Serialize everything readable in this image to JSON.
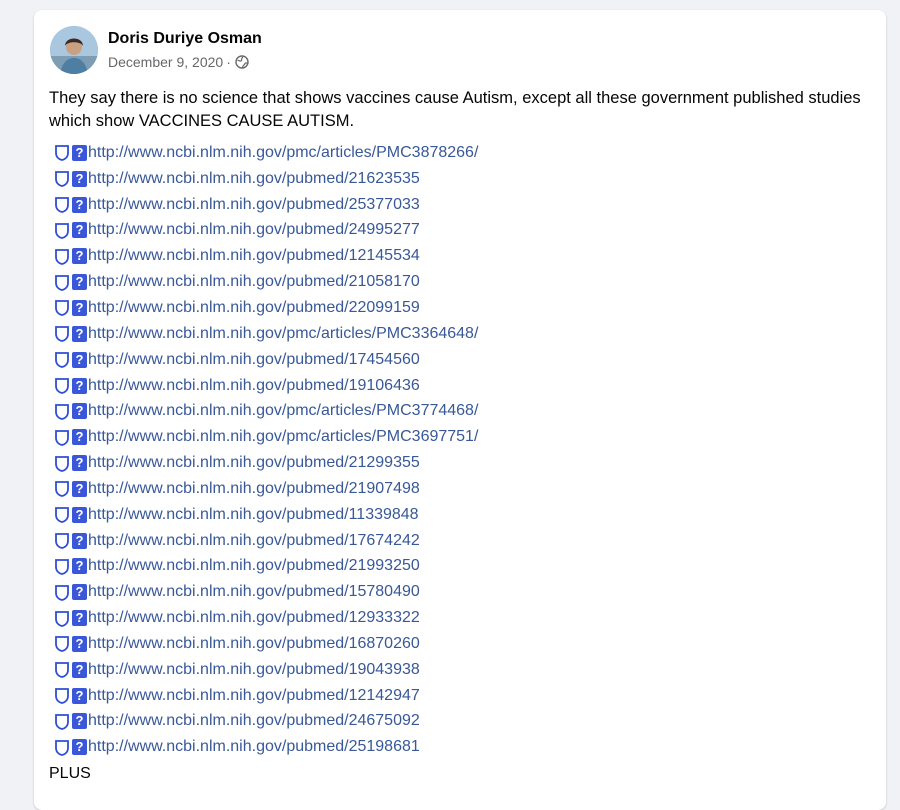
{
  "post": {
    "author": "Doris Duriye Osman",
    "date": "December 9, 2020",
    "separator": "·",
    "privacy_icon": "globe-icon",
    "text": "They say there is no science that shows vaccines cause Autism, except all these government published studies which show VACCINES CAUSE AUTISM.",
    "link_prefix_icons": [
      "shield-icon",
      "question-mark-icon"
    ],
    "link_prefix_question": "?",
    "links": [
      "http://www.ncbi.nlm.nih.gov/pmc/articles/PMC3878266/",
      "http://www.ncbi.nlm.nih.gov/pubmed/21623535",
      "http://www.ncbi.nlm.nih.gov/pubmed/25377033",
      "http://www.ncbi.nlm.nih.gov/pubmed/24995277",
      "http://www.ncbi.nlm.nih.gov/pubmed/12145534",
      "http://www.ncbi.nlm.nih.gov/pubmed/21058170",
      "http://www.ncbi.nlm.nih.gov/pubmed/22099159",
      "http://www.ncbi.nlm.nih.gov/pmc/articles/PMC3364648/",
      "http://www.ncbi.nlm.nih.gov/pubmed/17454560",
      "http://www.ncbi.nlm.nih.gov/pubmed/19106436",
      "http://www.ncbi.nlm.nih.gov/pmc/articles/PMC3774468/",
      "http://www.ncbi.nlm.nih.gov/pmc/articles/PMC3697751/",
      "http://www.ncbi.nlm.nih.gov/pubmed/21299355",
      "http://www.ncbi.nlm.nih.gov/pubmed/21907498",
      "http://www.ncbi.nlm.nih.gov/pubmed/11339848",
      "http://www.ncbi.nlm.nih.gov/pubmed/17674242",
      "http://www.ncbi.nlm.nih.gov/pubmed/21993250",
      "http://www.ncbi.nlm.nih.gov/pubmed/15780490",
      "http://www.ncbi.nlm.nih.gov/pubmed/12933322",
      "http://www.ncbi.nlm.nih.gov/pubmed/16870260",
      "http://www.ncbi.nlm.nih.gov/pubmed/19043938",
      "http://www.ncbi.nlm.nih.gov/pubmed/12142947",
      "http://www.ncbi.nlm.nih.gov/pubmed/24675092",
      "http://www.ncbi.nlm.nih.gov/pubmed/25198681"
    ],
    "trailing_text": "PLUS"
  },
  "colors": {
    "page_background": "#f0f2f5",
    "card_background": "#ffffff",
    "link": "#385898",
    "text": "#050505",
    "secondary_text": "#65676b",
    "question_box": "#3b57d9"
  }
}
